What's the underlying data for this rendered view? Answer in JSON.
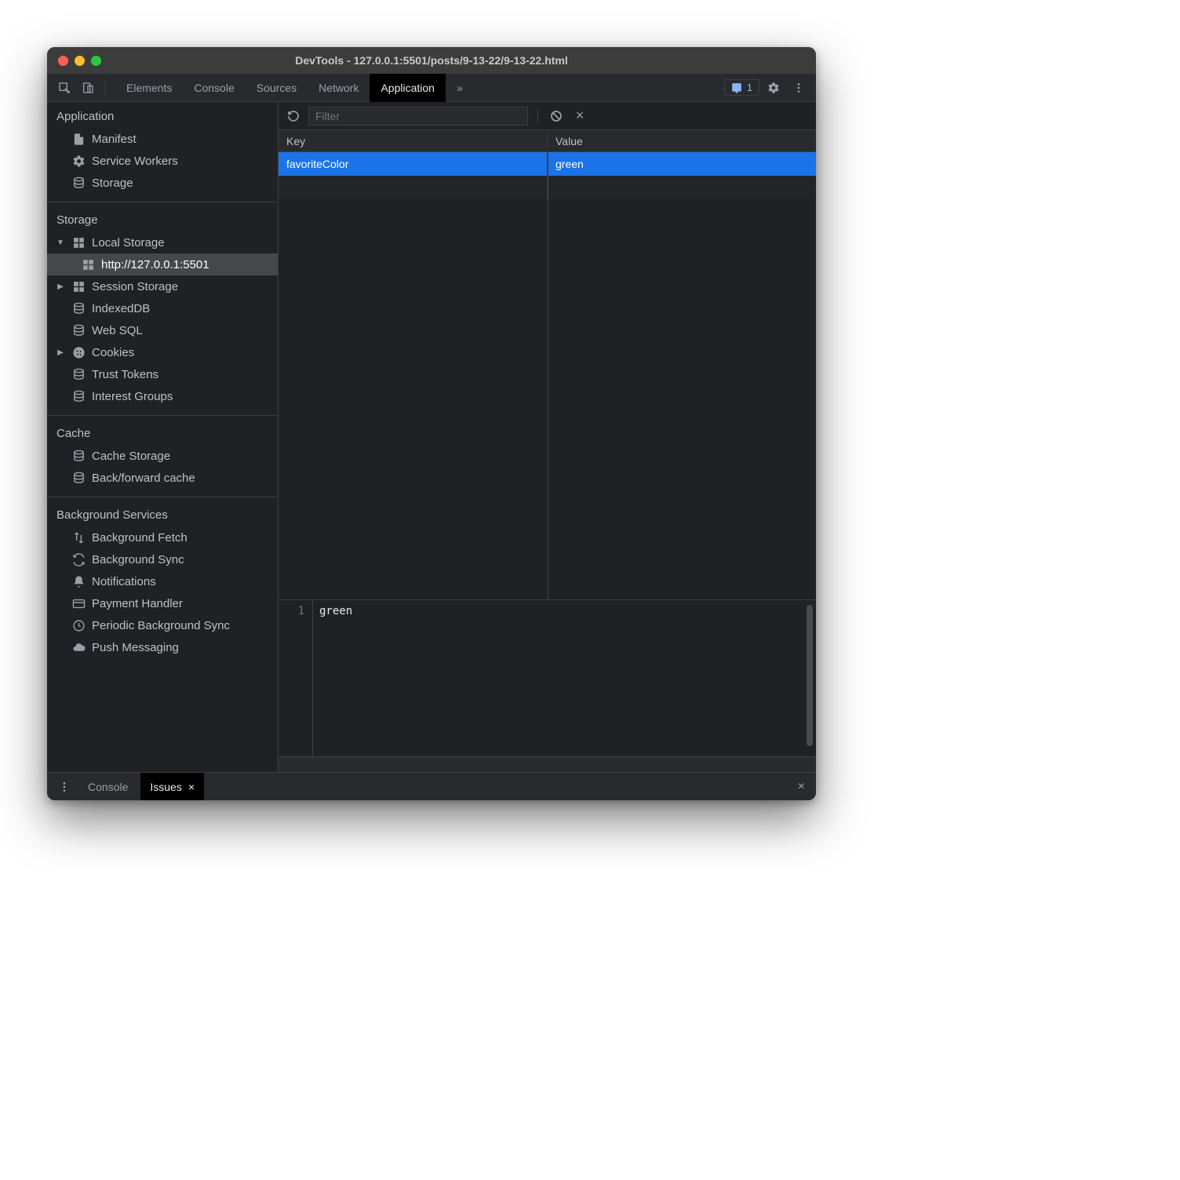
{
  "window": {
    "title": "DevTools - 127.0.0.1:5501/posts/9-13-22/9-13-22.html"
  },
  "toolbar": {
    "tabs": [
      "Elements",
      "Console",
      "Sources",
      "Network",
      "Application"
    ],
    "active_tab": "Application",
    "more": "»",
    "issues_count": "1"
  },
  "sidebar": {
    "sections": {
      "application": {
        "title": "Application",
        "items": [
          {
            "label": "Manifest",
            "icon": "file"
          },
          {
            "label": "Service Workers",
            "icon": "gear"
          },
          {
            "label": "Storage",
            "icon": "db"
          }
        ]
      },
      "storage": {
        "title": "Storage",
        "items": [
          {
            "label": "Local Storage",
            "icon": "grid",
            "arrow": "down",
            "children": [
              {
                "label": "http://127.0.0.1:5501",
                "icon": "grid",
                "selected": true
              }
            ]
          },
          {
            "label": "Session Storage",
            "icon": "grid",
            "arrow": "right"
          },
          {
            "label": "IndexedDB",
            "icon": "db"
          },
          {
            "label": "Web SQL",
            "icon": "db"
          },
          {
            "label": "Cookies",
            "icon": "cookie",
            "arrow": "right"
          },
          {
            "label": "Trust Tokens",
            "icon": "db"
          },
          {
            "label": "Interest Groups",
            "icon": "db"
          }
        ]
      },
      "cache": {
        "title": "Cache",
        "items": [
          {
            "label": "Cache Storage",
            "icon": "db"
          },
          {
            "label": "Back/forward cache",
            "icon": "db"
          }
        ]
      },
      "bg": {
        "title": "Background Services",
        "items": [
          {
            "label": "Background Fetch",
            "icon": "updown"
          },
          {
            "label": "Background Sync",
            "icon": "sync"
          },
          {
            "label": "Notifications",
            "icon": "bell"
          },
          {
            "label": "Payment Handler",
            "icon": "card"
          },
          {
            "label": "Periodic Background Sync",
            "icon": "clock"
          },
          {
            "label": "Push Messaging",
            "icon": "cloud"
          }
        ]
      }
    }
  },
  "content": {
    "filter_placeholder": "Filter",
    "columns": [
      "Key",
      "Value"
    ],
    "rows": [
      {
        "key": "favoriteColor",
        "value": "green",
        "selected": true
      }
    ],
    "preview": {
      "line_no": "1",
      "text": "green"
    }
  },
  "drawer": {
    "tabs": [
      "Console",
      "Issues"
    ],
    "active": "Issues",
    "close_glyph": "×"
  }
}
